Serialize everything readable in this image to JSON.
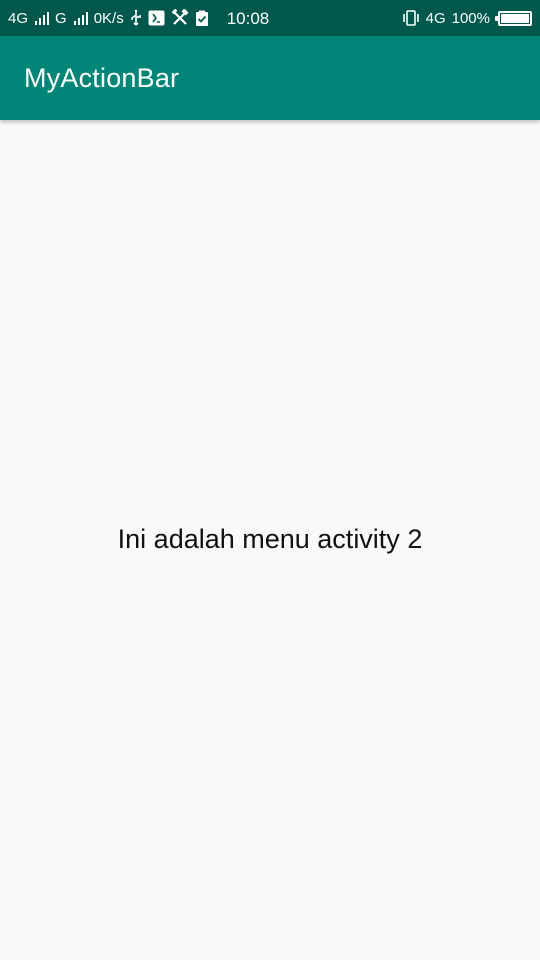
{
  "status_bar": {
    "network_1": "4G",
    "network_2": "G",
    "speed": "0K/s",
    "time": "10:08",
    "network_3": "4G",
    "battery": "100%",
    "icons": [
      "usb-icon",
      "usb-debug-icon",
      "tools-icon",
      "clipboard-check-icon",
      "vibrate-icon"
    ]
  },
  "app_bar": {
    "title": "MyActionBar",
    "color": "#008577"
  },
  "main": {
    "message": "Ini adalah menu activity 2"
  },
  "colors": {
    "status_bar": "#00574b",
    "primary": "#008577",
    "background": "#fafafa"
  }
}
